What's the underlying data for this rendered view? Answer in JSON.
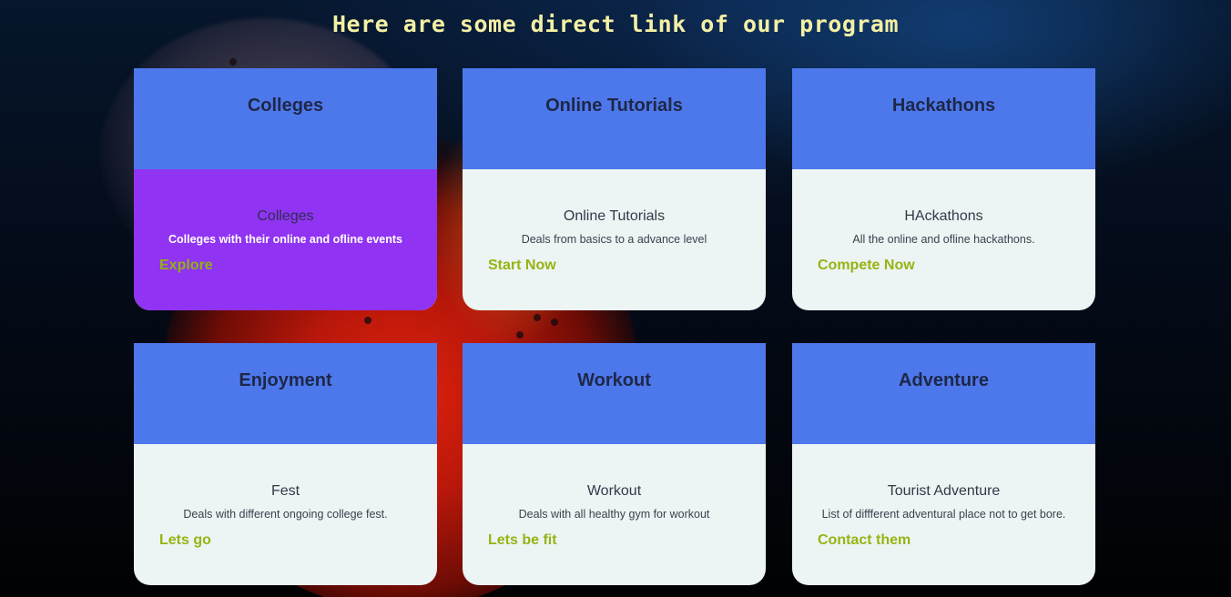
{
  "page": {
    "heading": "Here are some direct link of our program"
  },
  "colors": {
    "card_header": "#4d78ec",
    "card_body": "#ecf4f4",
    "card_active_body": "#9133f2",
    "link": "#98b312",
    "heading": "#f4f0a4"
  },
  "cards": [
    {
      "header": "Colleges",
      "subtitle": "Colleges",
      "description": "Colleges with their online and ofline events",
      "link": "Explore",
      "active": true
    },
    {
      "header": "Online Tutorials",
      "subtitle": "Online Tutorials",
      "description": "Deals from basics to a advance level",
      "link": "Start Now",
      "active": false
    },
    {
      "header": "Hackathons",
      "subtitle": "HAckathons",
      "description": "All the online and ofline hackathons.",
      "link": "Compete Now",
      "active": false
    },
    {
      "header": "Enjoyment",
      "subtitle": "Fest",
      "description": "Deals with different ongoing college fest.",
      "link": "Lets go",
      "active": false
    },
    {
      "header": "Workout",
      "subtitle": "Workout",
      "description": "Deals with all healthy gym for workout",
      "link": "Lets be fit",
      "active": false
    },
    {
      "header": "Adventure",
      "subtitle": "Tourist Adventure",
      "description": "List of diffferent adventural place not to get bore.",
      "link": "Contact them",
      "active": false
    }
  ]
}
